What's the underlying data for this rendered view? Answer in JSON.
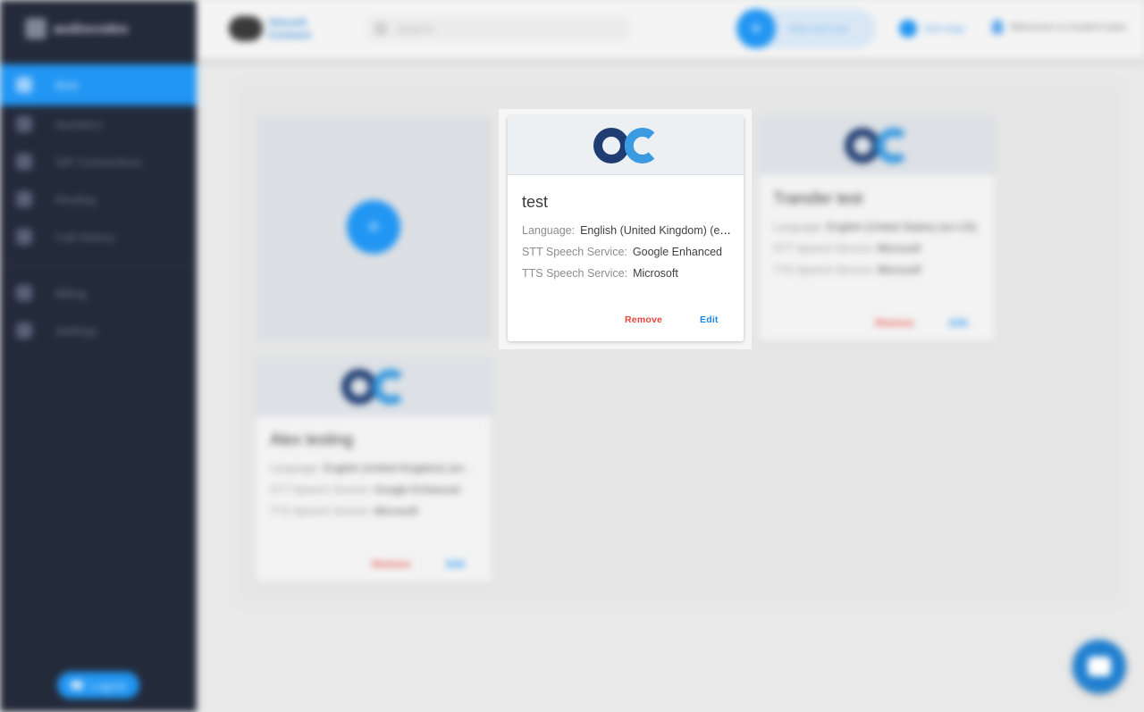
{
  "app": {
    "brand": "audiocodes"
  },
  "sidebar": {
    "items": [
      {
        "label": "Bots",
        "icon": "bots-icon"
      },
      {
        "label": "Numbers",
        "icon": "phone-icon"
      },
      {
        "label": "SIP Connections",
        "icon": "sip-icon"
      },
      {
        "label": "Routing",
        "icon": "routing-icon"
      },
      {
        "label": "Call History",
        "icon": "history-icon"
      },
      {
        "label": "Billing",
        "icon": "billing-icon"
      },
      {
        "label": "Settings",
        "icon": "settings-icon"
      }
    ],
    "logout_label": "Logout"
  },
  "topbar": {
    "brand_line1": "VoiceAI",
    "brand_line2": "Connect",
    "search_placeholder": "Search",
    "add_bot_label": "Add new bot",
    "help_label": "Get help",
    "account_label": "Welcome to AudioCodes"
  },
  "bots": [
    {
      "name": "test",
      "language_label": "Language:",
      "language": "English (United Kingdom) (en-GB)",
      "stt_label": "STT Speech Service:",
      "stt": "Google Enhanced",
      "tts_label": "TTS Speech Service:",
      "tts": "Microsoft",
      "remove_label": "Remove",
      "edit_label": "Edit"
    },
    {
      "name": "Transfer test",
      "language_label": "Language:",
      "language": "English (United States) (en-US)",
      "stt_label": "STT Speech Service:",
      "stt": "Microsoft",
      "tts_label": "TTS Speech Service:",
      "tts": "Microsoft",
      "remove_label": "Remove",
      "edit_label": "Edit"
    },
    {
      "name": "Alex testing",
      "language_label": "Language:",
      "language": "English (United Kingdom) (en-GB)",
      "stt_label": "STT Speech Service:",
      "stt": "Google Enhanced",
      "tts_label": "TTS Speech Service:",
      "tts": "Microsoft",
      "remove_label": "Remove",
      "edit_label": "Edit"
    }
  ],
  "add_card_symbol": "+",
  "colors": {
    "accent": "#2196f3",
    "danger": "#e5453b",
    "sidebar": "#232a3a",
    "logo_dark": "#1f3d73",
    "logo_light": "#3b9be0"
  }
}
